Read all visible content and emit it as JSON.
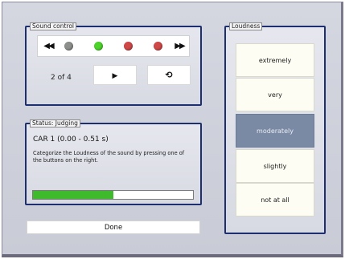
{
  "sound_control": {
    "title": "Sound control",
    "prev_icon": "skip-back-icon",
    "next_icon": "skip-forward-icon",
    "prev_glyph": "⏮",
    "next_glyph": "⏭",
    "leds": [
      {
        "name": "gray",
        "color": "#8c8f8c"
      },
      {
        "name": "green",
        "color": "#4cd42a"
      },
      {
        "name": "red",
        "color": "#d04848"
      },
      {
        "name": "red",
        "color": "#d04848"
      }
    ],
    "counter": "2 of 4",
    "play_glyph": "▶",
    "repeat_glyph": "⟲"
  },
  "status": {
    "title": "Status: Judging",
    "sound_label": "CAR 1 (0.00 - 0.51 s)",
    "instruction": "Categorize the Loudness of the sound by pressing one of the buttons on the right.",
    "progress": 0.5,
    "progress_color": "#3fba2c"
  },
  "done_label": "Done",
  "loudness": {
    "title": "Loudness",
    "options": [
      "extremely",
      "very",
      "moderately",
      "slightly",
      "not at all"
    ],
    "selected": "moderately",
    "selected_color": "#7b8aa4"
  }
}
